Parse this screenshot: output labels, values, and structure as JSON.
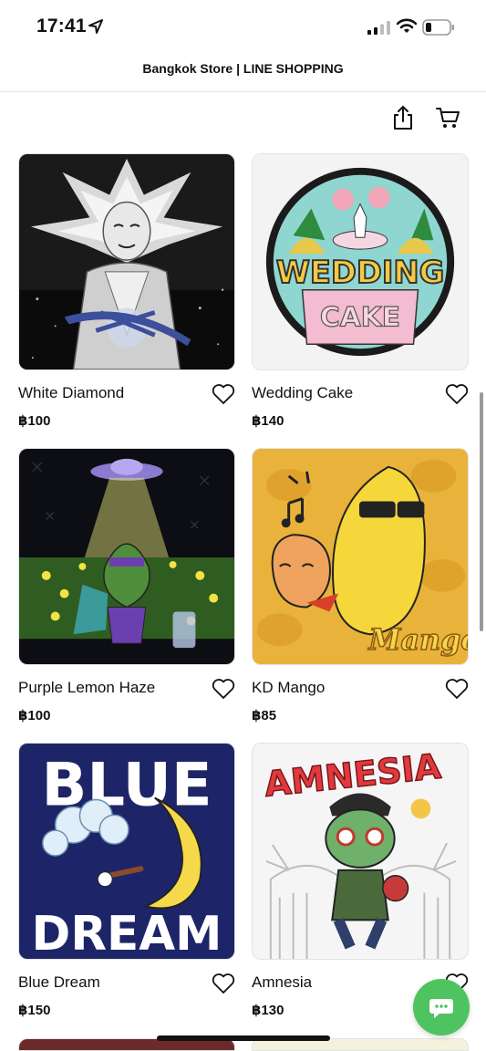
{
  "status_bar": {
    "time": "17:41"
  },
  "nav": {
    "title": "Bangkok Store | LINE SHOPPING"
  },
  "toolbar": {
    "share_icon": "share-icon",
    "cart_icon": "cart-icon"
  },
  "products": [
    {
      "name": "White Diamond",
      "price": "฿100"
    },
    {
      "name": "Wedding Cake",
      "price": "฿140"
    },
    {
      "name": "Purple Lemon Haze",
      "price": "฿100"
    },
    {
      "name": "KD Mango",
      "price": "฿85"
    },
    {
      "name": "Blue Dream",
      "price": "฿150"
    },
    {
      "name": "Amnesia",
      "price": "฿130"
    }
  ],
  "artwork_text": {
    "wedding_top": "WEDDING",
    "wedding_bottom": "CAKE",
    "mango": "Mango",
    "blue": "BLUE",
    "dream": "DREAM",
    "amnesia": "AMNESIA"
  },
  "colors": {
    "chat_button": "#4fc35f",
    "text": "#111111"
  }
}
